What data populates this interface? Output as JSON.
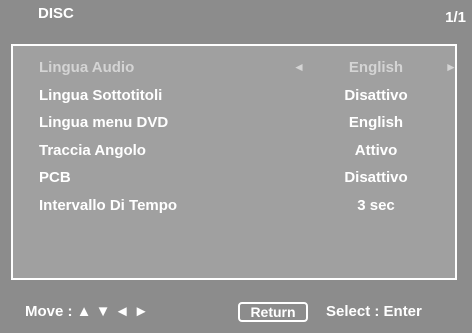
{
  "header": {
    "title": "DISC",
    "page": "1/1"
  },
  "menu": {
    "items": [
      {
        "label": "Lingua Audio",
        "value": "English",
        "arrow_left": "◄",
        "arrow_right": "►",
        "selected": true
      },
      {
        "label": "Lingua Sottotitoli",
        "value": "Disattivo"
      },
      {
        "label": "Lingua menu DVD",
        "value": "English"
      },
      {
        "label": "Traccia Angolo",
        "value": "Attivo"
      },
      {
        "label": "PCB",
        "value": "Disattivo"
      },
      {
        "label": "Intervallo Di Tempo",
        "value": "3 sec"
      }
    ]
  },
  "footer": {
    "move_label": "Move : ▲ ▼ ◄ ►",
    "return_label": "Return",
    "select_label": "Select : Enter"
  },
  "colors": {
    "background": "#8c8c8c",
    "panel": "#a0a0a0",
    "text": "#ffffff",
    "selected_text": "#d4d4d4"
  }
}
